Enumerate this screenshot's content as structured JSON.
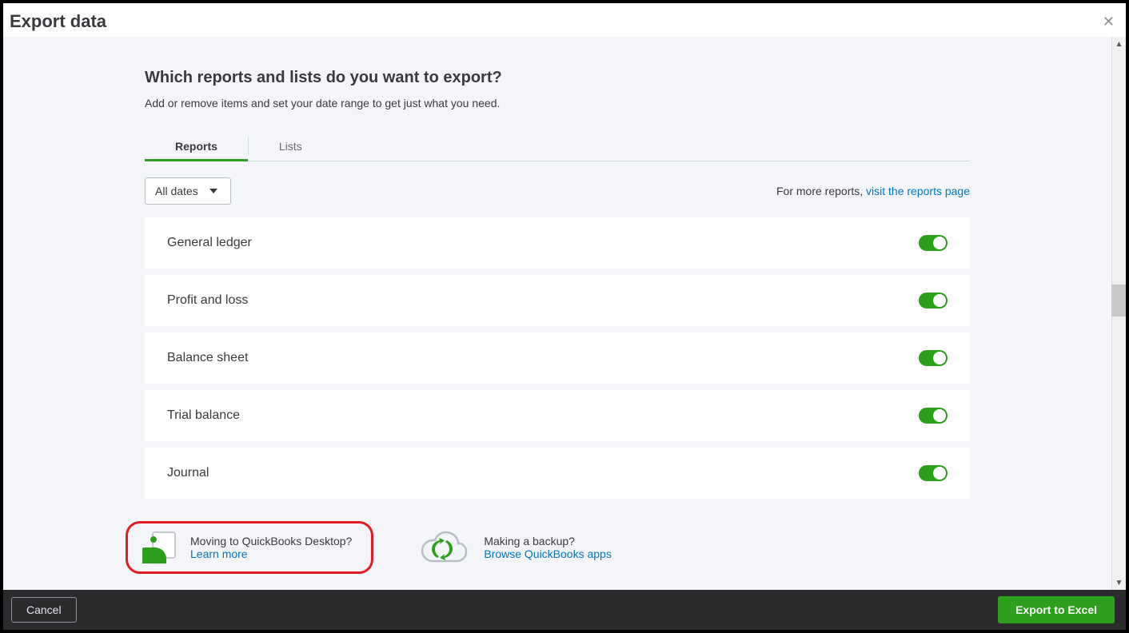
{
  "title": "Export data",
  "heading": "Which reports and lists do you want to export?",
  "subheading": "Add or remove items and set your date range to get just what you need.",
  "tabs": {
    "reports": "Reports",
    "lists": "Lists"
  },
  "date_select": "All dates",
  "more_reports_prefix": "For more reports, ",
  "more_reports_link": "visit the reports page",
  "reports": [
    {
      "label": "General ledger",
      "on": true
    },
    {
      "label": "Profit and loss",
      "on": true
    },
    {
      "label": "Balance sheet",
      "on": true
    },
    {
      "label": "Trial balance",
      "on": true
    },
    {
      "label": "Journal",
      "on": true
    }
  ],
  "promo_desktop": {
    "question": "Moving to QuickBooks Desktop?",
    "link": "Learn more"
  },
  "promo_backup": {
    "question": "Making a backup?",
    "link": "Browse QuickBooks apps"
  },
  "footer": {
    "cancel": "Cancel",
    "export": "Export to Excel"
  }
}
